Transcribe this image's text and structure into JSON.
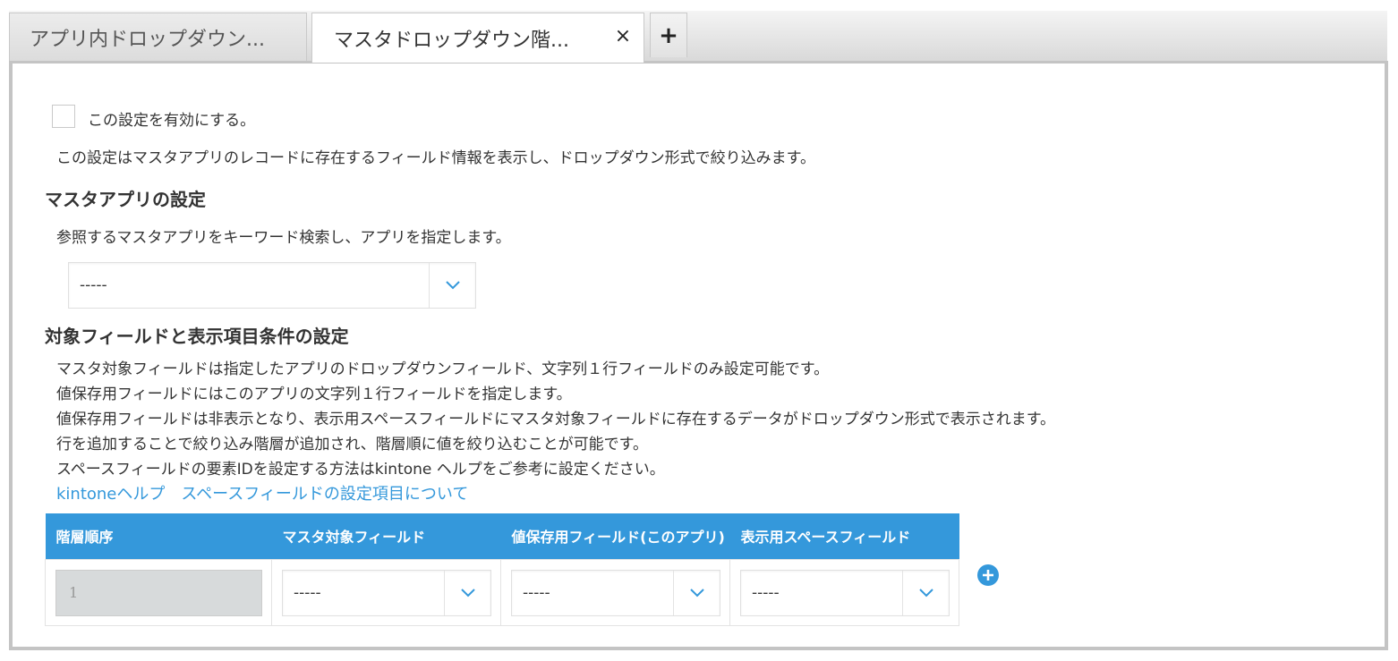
{
  "tabs": [
    {
      "label": "アプリ内ドロップダウン..."
    },
    {
      "label": "マスタドロップダウン階...",
      "close": "×"
    }
  ],
  "tab_add_label": "+",
  "enable": {
    "label": "この設定を有効にする。"
  },
  "intro": "この設定はマスタアプリのレコードに存在するフィールド情報を表示し、ドロップダウン形式で絞り込みます。",
  "master_app": {
    "heading": "マスタアプリの設定",
    "desc": "参照するマスタアプリをキーワード検索し、アプリを指定します。",
    "select_value": "-----"
  },
  "field_settings": {
    "heading": "対象フィールドと表示項目条件の設定",
    "desc_lines": [
      "マスタ対象フィールドは指定したアプリのドロップダウンフィールド、文字列１行フィールドのみ設定可能です。",
      "値保存用フィールドにはこのアプリの文字列１行フィールドを指定します。",
      "値保存用フィールドは非表示となり、表示用スペースフィールドにマスタ対象フィールドに存在するデータがドロップダウン形式で表示されます。",
      "行を追加することで絞り込み階層が追加され、階層順に値を絞り込むことが可能です。",
      "スペースフィールドの要素IDを設定する方法はkintone ヘルプをご参考に設定ください。"
    ],
    "help_link": "kintoneヘルプ　スペースフィールドの設定項目について"
  },
  "table": {
    "headers": [
      "階層順序",
      "マスタ対象フィールド",
      "値保存用フィールド(このアプリ)",
      "表示用スペースフィールド"
    ],
    "rows": [
      {
        "order": "1",
        "master_field": "-----",
        "save_field": "-----",
        "space_field": "-----"
      }
    ]
  },
  "colors": {
    "accent": "#3498db",
    "tabbar": "#dcdcdc",
    "panel_border": "#c4c4c4"
  },
  "icons": {
    "add_row": "plus-circle-icon",
    "dropdown": "chevron-down-icon",
    "close": "close-icon"
  }
}
